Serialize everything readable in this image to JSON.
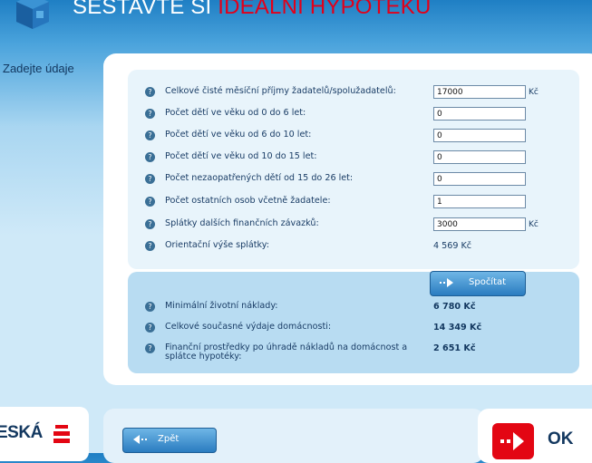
{
  "header": {
    "title_part1": "SESTAVTE SI ",
    "title_part2": "IDEÁLNÍ HYPOTÉKU",
    "accent_color": "#e2001a"
  },
  "sidebar": {
    "step_label": "Zadejte údaje"
  },
  "form": {
    "help_icon": "?",
    "rows": [
      {
        "label": "Celkové čisté měsíční příjmy žadatelů/spolužadatelů:",
        "value": "17000",
        "unit": "Kč"
      },
      {
        "label": "Počet dětí ve věku od 0 do 6 let:",
        "value": "0"
      },
      {
        "label": "Počet dětí ve věku od 6 do 10 let:",
        "value": "0"
      },
      {
        "label": "Počet dětí ve věku od 10 do 15 let:",
        "value": "0"
      },
      {
        "label": "Počet nezaopatřených dětí od 15 do 26 let:",
        "value": "0"
      },
      {
        "label": "Počet ostatních osob včetně žadatele:",
        "value": "1"
      },
      {
        "label": "Splátky dalších finančních závazků:",
        "value": "3000",
        "unit": "Kč"
      }
    ],
    "estimate": {
      "label": "Orientační výše splátky:",
      "value": "4 569 Kč"
    }
  },
  "calc_button": {
    "label": "Spočítat"
  },
  "results": [
    {
      "label": "Minimální životní náklady:",
      "value": "6 780 Kč"
    },
    {
      "label": "Celkové současné výdaje domácnosti:",
      "value": "14 349 Kč"
    },
    {
      "label_line1": "Finanční prostředky po úhradě nákladů na domácnost a",
      "label_line2": "splátce hypotéky:",
      "value": "2 651 Kč"
    }
  ],
  "footer": {
    "back_label": "Zpět",
    "ok_label": "OK",
    "bank_name": "ESKÁ"
  }
}
